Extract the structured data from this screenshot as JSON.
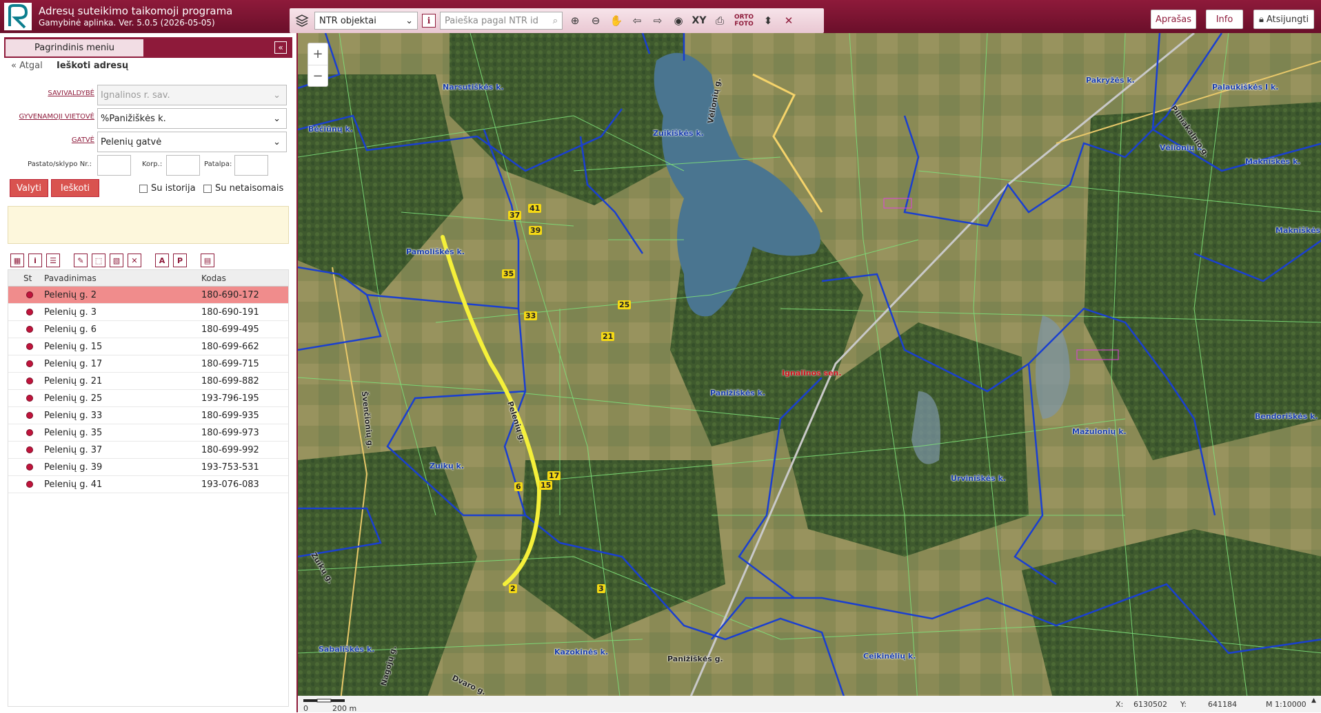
{
  "app": {
    "title": "Adresų suteikimo taikomoji programa",
    "subtitle": "Gamybinė aplinka. Ver. 5.0.5 (2026-05-05)"
  },
  "toolbar": {
    "layer_select": "NTR objektai",
    "search_placeholder": "Paieška pagal NTR id",
    "xy_label": "XY",
    "ortho_line1": "ORTO",
    "ortho_line2": "FOTO"
  },
  "header_buttons": {
    "aprasas": "Aprašas",
    "info": "Info",
    "logout": "Atsijungti"
  },
  "left_panel": {
    "menu_tab": "Pagrindinis meniu",
    "back": "« Atgal",
    "title": "Ieškoti adresų",
    "savivaldybe_label": "SAVIVALDYBĖ",
    "savivaldybe_value": "Ignalinos r. sav.",
    "gyvenamoji_label": "GYVENAMOJI VIETOVĖ",
    "gyvenamoji_value": "%Panižiškės k.",
    "gatve_label": "GATVĖ",
    "gatve_value": "Pelenių gatvė",
    "pastato_label": "Pastato/sklypo Nr.:",
    "korp_label": "Korp.:",
    "patalpa_label": "Patalpa:",
    "valyti": "Valyti",
    "ieskoti": "Ieškoti",
    "su_istorija": "Su istorija",
    "su_netaisomais": "Su netaisomais"
  },
  "table": {
    "headers": {
      "st": "St",
      "name": "Pavadinimas",
      "code": "Kodas"
    },
    "rows": [
      {
        "name": "Pelenių g. 2",
        "code": "180-690-172"
      },
      {
        "name": "Pelenių g. 3",
        "code": "180-690-191"
      },
      {
        "name": "Pelenių g. 6",
        "code": "180-699-495"
      },
      {
        "name": "Pelenių g. 15",
        "code": "180-699-662"
      },
      {
        "name": "Pelenių g. 17",
        "code": "180-699-715"
      },
      {
        "name": "Pelenių g. 21",
        "code": "180-699-882"
      },
      {
        "name": "Pelenių g. 25",
        "code": "193-796-195"
      },
      {
        "name": "Pelenių g. 33",
        "code": "180-699-935"
      },
      {
        "name": "Pelenių g. 35",
        "code": "180-699-973"
      },
      {
        "name": "Pelenių g. 37",
        "code": "180-699-992"
      },
      {
        "name": "Pelenių g. 39",
        "code": "193-753-531"
      },
      {
        "name": "Pelenių g. 41",
        "code": "193-076-083"
      }
    ]
  },
  "map": {
    "places": [
      "Narsutiškės k.",
      "Zuikiškės k.",
      "Bėčiūnų k.",
      "Pamoliškės k.",
      "Panižiškės k.",
      "Zuikų k.",
      "Pakryžės k.",
      "Palaukiškės I k.",
      "Vėlionių k.",
      "Makniškės k.",
      "Makniškės k.",
      "Urviniškės k.",
      "Mažulonių k.",
      "Bendoriškės k.",
      "Sabališkės k.",
      "Kazokinės k.",
      "Ceikinėlių k."
    ],
    "seniunija": "Ignalinos sen.",
    "roads": [
      "Pelenių g.",
      "Švenčionių g.",
      "Zuikų g.",
      "Nagojų g.",
      "Dvaro g.",
      "Panižiškės g.",
      "Vėlionių g.",
      "Pilniakalnio g."
    ],
    "houses": [
      "41",
      "37",
      "39",
      "35",
      "33",
      "25",
      "21",
      "17",
      "15",
      "6",
      "2",
      "3"
    ],
    "zoom_in": "+",
    "zoom_out": "−"
  },
  "status": {
    "scale_zero": "0",
    "scale_dist": "200 m",
    "x_label": "X:",
    "x_value": "6130502",
    "y_label": "Y:",
    "y_value": "641184",
    "map_scale": "M 1:10000"
  },
  "colors": {
    "brand": "#8e1a3a",
    "selected_row": "#f08c8c",
    "boundary": "#1a3fd0",
    "parcel": "#7ee07a",
    "street_highlight": "#f5f03a"
  }
}
